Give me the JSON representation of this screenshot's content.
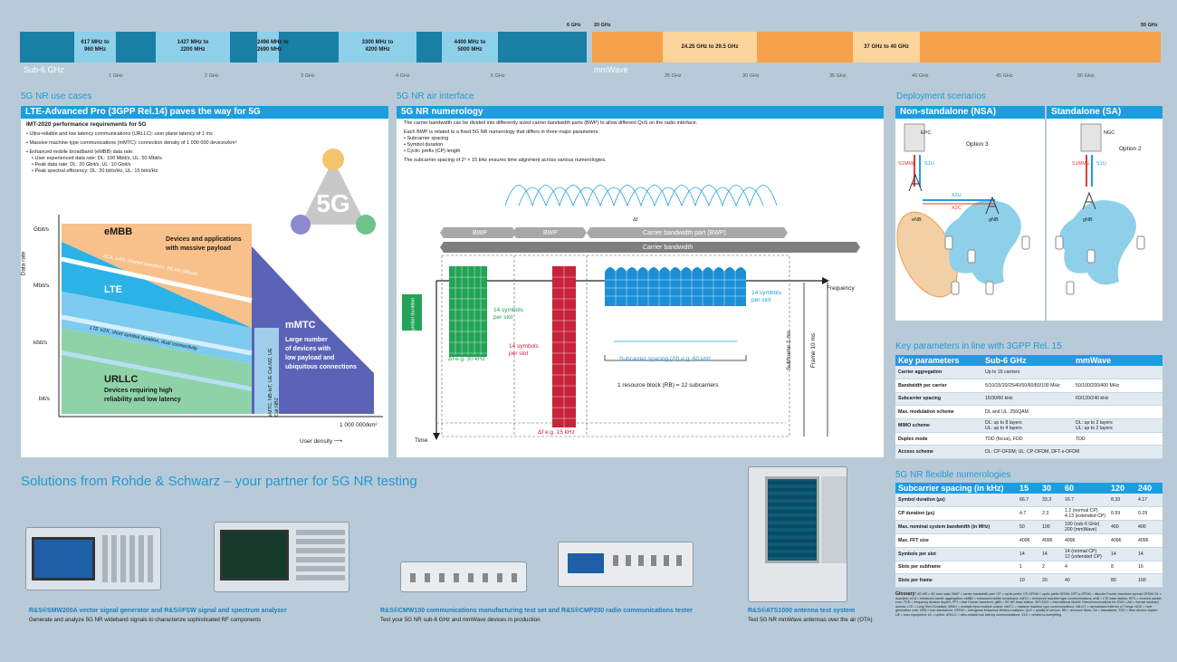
{
  "spectrum": {
    "top_left": "6 GHz",
    "top_mid": "20 GHz",
    "top_right": "55 GHz",
    "sub6_label": "Sub-6 GHz",
    "mmwave_label": "mmWave",
    "sub6_bands": [
      "617 MHz to\n960 MHz",
      "1427 MHz to\n2200 MHz",
      "2496 MHz to\n2690 MHz",
      "3300 MHz to\n4200 MHz",
      "4400 MHz to\n5000 MHz"
    ],
    "mmwave_bands": [
      "24.25 GHz to 29.5 GHz",
      "37 GHz to 40 GHz"
    ],
    "sub6_ticks": [
      "1 GHz",
      "2 GHz",
      "3 GHz",
      "4 GHz",
      "5 GHz"
    ],
    "mmwave_ticks": [
      "25 GHz",
      "30 GHz",
      "35 GHz",
      "40 GHz",
      "45 GHz",
      "50 GHz"
    ]
  },
  "use_cases": {
    "section": "5G NR use cases",
    "header": "LTE-Advanced Pro (3GPP Rel.14) paves the way for 5G",
    "imt_title": "IMT-2020 performance requirements for 5G",
    "bullets": [
      "Ultra-reliable and low latency communications (URLLC): user plane latency of 1 ms",
      "Massive machine type communications (mMTC): connection density of 1 000 000 devices/km²",
      "Enhanced mobile broadband (eMBB) data rate:"
    ],
    "sub_bullets": [
      "User experienced data rate: DL: 100 Mbit/s, UL: 50 Mbit/s",
      "Peak data rate: DL: 20 Gbit/s, UL: 10 Gbit/s",
      "Peak spectral efficiency: DL: 20 bit/s/Hz, UL: 15 bit/s/Hz"
    ],
    "logo_5g": "5G",
    "y_ticks": [
      "Gbit/s",
      "Mbit/s",
      "kbit/s",
      "bit/s"
    ],
    "y_axis": "Data rate",
    "x_axis": "User density",
    "x_value": "1 000 000/km²",
    "embb": "eMBB",
    "embb_desc": "Devices and applications\nwith massive payload",
    "lte": "LTE",
    "urllc": "URLLC",
    "urllc_desc": "Devices requiring high\nreliability and low latency",
    "mmtc": "mMTC",
    "mmtc_desc": "Large number\nof devices with\nlow payload and\nubiquitous connections",
    "band1": "eCA, LAA, shared spectrum, WLAN offload",
    "band2": "LTE V2X, short symbol duration, dual connectivity",
    "band3": "eMTC, NB-IoT, UE Cat.M2, UE Cat.NB2"
  },
  "air": {
    "section": "5G NR air interface",
    "header": "5G NR numerology",
    "p1": "The carrier bandwidth can be divided into differently sized carrier bandwidth parts (BWP) to allow different QoS on the radio interface.",
    "p2": "Each BWP is related to a fixed 5G NR numerology that differs in three major parameters:",
    "list": [
      "Subcarrier spacing",
      "Symbol duration",
      "Cyclic prefix (CP) length"
    ],
    "p3": "The subcarrier spacing of 2ⁿ × 15 kHz ensures time alignment across various numerologies.",
    "df": "Δf",
    "bwp": "BWP",
    "cbp": "Carrier bandwidth part (BWP)",
    "carrier": "Carrier bandwidth",
    "frequency": "Frequency",
    "time": "Time",
    "symbol_duration": "Symbol duration",
    "sym14a": "14 symbols\nper slot",
    "sym14b": "14 symbols\nper slot",
    "sym14c": "14 symbols\nper slot",
    "df30": "Δf e.g. 30 kHz",
    "df15": "Δf e.g. 15 kHz",
    "df60": "Subcarrier spacing (Δf) e.g. 60 kHz",
    "rb": "1 resource block (RB) = 12 subcarriers",
    "subframe": "Subframe 1 ms",
    "frame": "Frame 10 ms"
  },
  "deploy": {
    "section": "Deployment scenarios",
    "nsa": "Non-standalone (NSA)",
    "sa": "Standalone (SA)",
    "epc": "EPC",
    "ngc": "NGC",
    "opt3": "Option 3",
    "opt2": "Option 2",
    "enb": "eNB",
    "gnb": "gNB",
    "s1mme": "S1MME",
    "s1u": "S1U",
    "x2u": "X2U",
    "x2c": "X2C"
  },
  "keyparams": {
    "section": "Key parameters in line with 3GPP Rel. 15",
    "headers": [
      "Key parameters",
      "Sub-6 GHz",
      "mmWave"
    ],
    "rows": [
      [
        "Carrier aggregation",
        "Up to 16 carriers",
        ""
      ],
      [
        "Bandwidth per carrier",
        "5/10/15/20/25/40/50/60/80/100 MHz",
        "50/100/200/400 MHz"
      ],
      [
        "Subcarrier spacing",
        "15/30/60 kHz",
        "60/120/240 kHz"
      ],
      [
        "Max. modulation scheme",
        "DL and UL: 256QAM",
        ""
      ],
      [
        "MIMO scheme",
        "DL: up to 8 layers\nUL: up to 4 layers",
        "DL: up to 2 layers\nUL: up to 2 layers"
      ],
      [
        "Duplex mode",
        "TDD (focus), FDD",
        "TDD"
      ],
      [
        "Access scheme",
        "DL: CP-OFDM; UL: CP-OFDM, DFT-s-OFDM",
        ""
      ]
    ]
  },
  "numerology": {
    "section": "5G NR flexible numerologies",
    "headers": [
      "Subcarrier spacing (in kHz)",
      "15",
      "30",
      "60",
      "120",
      "240"
    ],
    "rows": [
      [
        "Symbol duration (µs)",
        "66.7",
        "33.3",
        "16.7",
        "8.33",
        "4.17"
      ],
      [
        "CP duration (µs)",
        "4.7",
        "2.3",
        "1.2 (normal CP)\n4.13 (extended CP)",
        "0.59",
        "0.29"
      ],
      [
        "Max. nominal system bandwidth (in MHz)",
        "50",
        "100",
        "100 (sub-6 GHz)\n200 (mmWave)",
        "400",
        "400"
      ],
      [
        "Max. FFT size",
        "4096",
        "4096",
        "4096",
        "4096",
        "4096"
      ],
      [
        "Symbols per slot",
        "14",
        "14",
        "14 (normal CP)\n12 (extended CP)",
        "14",
        "14"
      ],
      [
        "Slots per subframe",
        "1",
        "2",
        "4",
        "8",
        "16"
      ],
      [
        "Slots per frame",
        "10",
        "20",
        "40",
        "80",
        "160"
      ]
    ],
    "glossary_title": "Glossary:",
    "glossary": "5G NR = 5G new radio; BWP = carrier bandwidth part; CP = cyclic prefix; CP-OFDM = cyclic prefix OFDM; DFT-s-OFDM = discrete Fourier transform spread OFDM; DL = downlink; eCA = enhanced carrier aggregation; eMBB = enhanced mobile broadband; eMTC = enhanced machine type communications; eNB = LTE base station; EPC = evolved packet core; FDD = frequency division duplex; FFT = fast Fourier transform; gNB = 5G NR base station; IMT-2020 = International Mobile Telecommunications for 2020; LAA = license assisted access; LTE = Long Term Evolution; MIMO = multiple input multiple output; mMTC = massive machine type communications; NB-IoT = narrowband Internet of Things; NGC = next generation core; NSA = non-standalone; OFDM = orthogonal frequency division multiplex; QoS = quality of service; RB = resource block; SA = standalone; TDD = time division duplex; UE = user equipment; UL = uplink; URLLC = ultra-reliable low latency communications; V2X = vehicle-to-everything"
  },
  "solutions": {
    "title": "Solutions from Rohde & Schwarz – your partner for 5G NR testing",
    "items": [
      {
        "name": "R&S®SMW200A vector signal generator and R&S®FSW signal and spectrum analyzer",
        "desc": "Generate and analyze 5G NR wideband signals to characterize sophisticated RF components"
      },
      {
        "name": "R&S®CMW100 communications manufacturing test set and R&S®CMP200 radio communications tester",
        "desc": "Test your 5G NR sub-6 GHz and mmWave devices in production"
      },
      {
        "name": "R&S®ATS1000 antenna test system",
        "desc": "Test 5G NR mmWave antennas over the air (OTA)"
      }
    ]
  }
}
